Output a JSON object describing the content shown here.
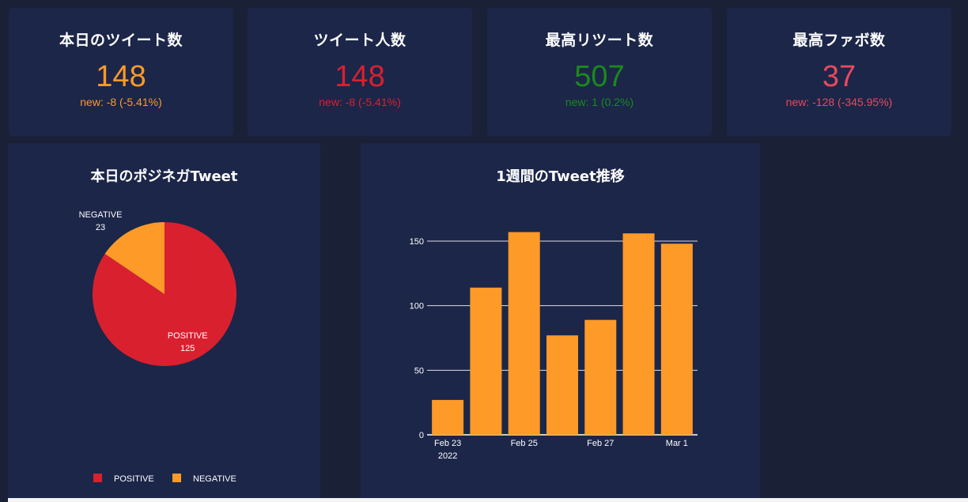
{
  "colors": {
    "background": "#1a2035",
    "card": "#1c2649",
    "orange": "#fd9a28",
    "red": "#d9202f",
    "green": "#1a8a1a",
    "pink": "#e8495e"
  },
  "kpis": [
    {
      "title": "本日のツイート数",
      "value": "148",
      "delta": "new: -8 (-5.41%)",
      "color": "#fd9a28"
    },
    {
      "title": "ツイート人数",
      "value": "148",
      "delta": "new: -8 (-5.41%)",
      "color": "#d9202f"
    },
    {
      "title": "最高リツート数",
      "value": "507",
      "delta": "new: 1 (0.2%)",
      "color": "#1a8a1a"
    },
    {
      "title": "最高ファボ数",
      "value": "37",
      "delta": "new: -128 (-345.95%)",
      "color": "#e8495e"
    }
  ],
  "pie_panel": {
    "title": "本日のポジネガTweet",
    "legend": [
      {
        "label": "POSITIVE",
        "color": "#d9202f"
      },
      {
        "label": "NEGATIVE",
        "color": "#fd9a28"
      }
    ]
  },
  "bar_panel": {
    "title": "1週間のTweet推移",
    "x_year": "2022"
  },
  "chart_data": [
    {
      "type": "pie",
      "title": "本日のポジネガTweet",
      "labels": [
        "POSITIVE",
        "NEGATIVE"
      ],
      "values": [
        125,
        23
      ],
      "colors": [
        "#d9202f",
        "#fd9a28"
      ]
    },
    {
      "type": "bar",
      "title": "1週間のTweet推移",
      "categories": [
        "2022-02-23",
        "2022-02-24",
        "2022-02-25",
        "2022-02-26",
        "2022-02-27",
        "2022-02-28",
        "2022-03-01"
      ],
      "values": [
        27,
        114,
        157,
        77,
        89,
        156,
        148
      ],
      "ylim": [
        0,
        165
      ],
      "yticks": [
        0,
        50,
        100,
        150
      ],
      "xtick_labels": [
        "Feb 23",
        "Feb 25",
        "Feb 27",
        "Mar 1"
      ],
      "xtick_index": [
        0,
        2,
        4,
        6
      ],
      "color": "#fd9a28",
      "grid": true
    }
  ]
}
